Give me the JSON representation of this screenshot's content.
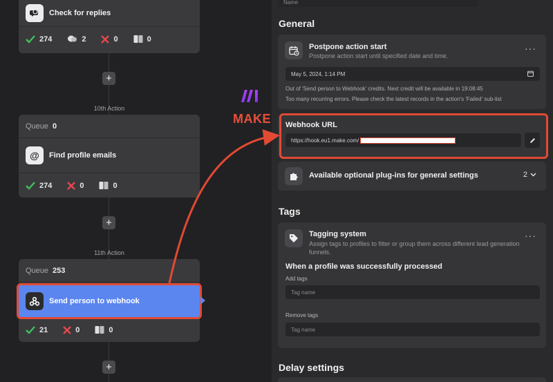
{
  "flow": {
    "top_card": {
      "title": "Check for replies",
      "stats": {
        "success": "274",
        "replies": "2",
        "failed": "0",
        "skipped": "0"
      }
    },
    "action_10": {
      "label": "10th Action",
      "queue_label": "Queue",
      "queue_count": "0",
      "title": "Find profile emails",
      "stats": {
        "success": "274",
        "failed": "0",
        "skipped": "0"
      }
    },
    "action_11": {
      "label": "11th Action",
      "queue_label": "Queue",
      "queue_count": "253",
      "title": "Send person to webhook",
      "stats": {
        "success": "21",
        "failed": "0",
        "skipped": "0"
      }
    },
    "add_symbol": "+"
  },
  "annotation": {
    "make_text": "MAKE"
  },
  "panel": {
    "name_placeholder": "Name",
    "general": {
      "title": "General",
      "postpone": {
        "title": "Postpone action start",
        "subtitle": "Postpone action start until specified date and time.",
        "date_value": "May 5, 2024, 1:14 PM",
        "note_credits": "Out of 'Send person to Webhook' credits. Next credit will be available in 19:08:45",
        "note_errors": "Too many recurring errors. Please check the latest records in the action's 'Failed' sub-list",
        "menu": "···"
      },
      "webhook": {
        "label": "Webhook URL",
        "url_value": "https://hook.eu1.make.com/"
      },
      "plugins": {
        "title": "Available optional plug-ins for general settings",
        "count": "2"
      }
    },
    "tags": {
      "title": "Tags",
      "system": {
        "title": "Tagging system",
        "subtitle_1": "Assign tags to profiles to filter or group them across different lead generation",
        "subtitle_2": "funnels.",
        "menu": "···"
      },
      "processed_title": "When a profile was successfully processed",
      "add_tags_label": "Add tags",
      "add_tags_placeholder": "Tag name",
      "remove_tags_label": "Remove tags",
      "remove_tags_placeholder": "Tag name"
    },
    "delay": {
      "title": "Delay settings"
    }
  },
  "colors": {
    "background": "#212123",
    "card": "#3a3a3d",
    "selected_action": "#5b86f0",
    "highlight_red": "#e24a33",
    "success_green": "#3fbf5a",
    "failed_red": "#e5484d",
    "make_purple": "#8b3ff0"
  }
}
